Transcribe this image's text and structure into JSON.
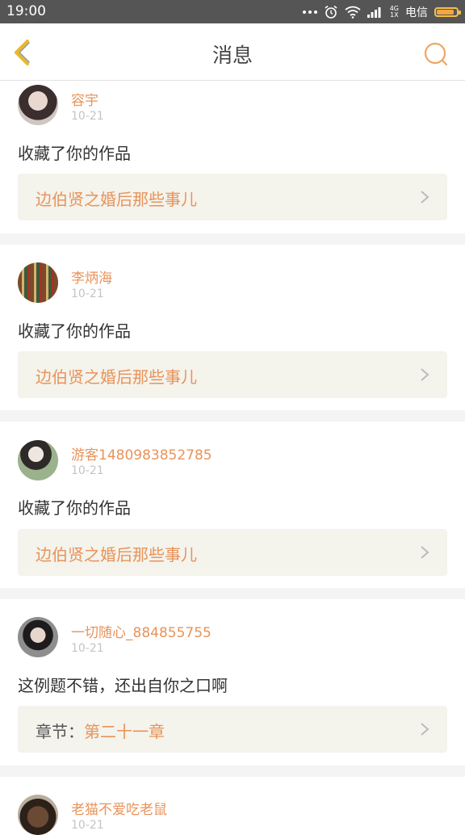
{
  "status": {
    "time": "19:00",
    "network": "4G",
    "network_sub": "1X",
    "carrier": "电信",
    "battery_level": 0.8
  },
  "header": {
    "title": "消息",
    "back_icon": "back-chevron-icon",
    "search_icon": "search-icon"
  },
  "colors": {
    "accent": "#e8935a",
    "card_bg": "#f4f3ec",
    "back_yellow": "#e9b928"
  },
  "messages": [
    {
      "user": "容宇",
      "date": "10-21",
      "text": "收藏了你的作品",
      "link_prefix": "",
      "link": "边伯贤之婚后那些事儿",
      "avatar": "avatar-woman-dark"
    },
    {
      "user": "李炳海",
      "date": "10-21",
      "text": "收藏了你的作品",
      "link_prefix": "",
      "link": "边伯贤之婚后那些事儿",
      "avatar": "avatar-bookshelf"
    },
    {
      "user": "游客1480983852785",
      "date": "10-21",
      "text": "收藏了你的作品",
      "link_prefix": "",
      "link": "边伯贤之婚后那些事儿",
      "avatar": "avatar-girl-cat"
    },
    {
      "user": "一切随心_884855755",
      "date": "10-21",
      "text": "这例题不错，还出自你之口啊",
      "link_prefix": "章节：",
      "link": "第二十一章",
      "avatar": "avatar-sunglasses"
    },
    {
      "user": "老猫不爱吃老鼠",
      "date": "10-21",
      "avatar": "avatar-dog"
    }
  ]
}
